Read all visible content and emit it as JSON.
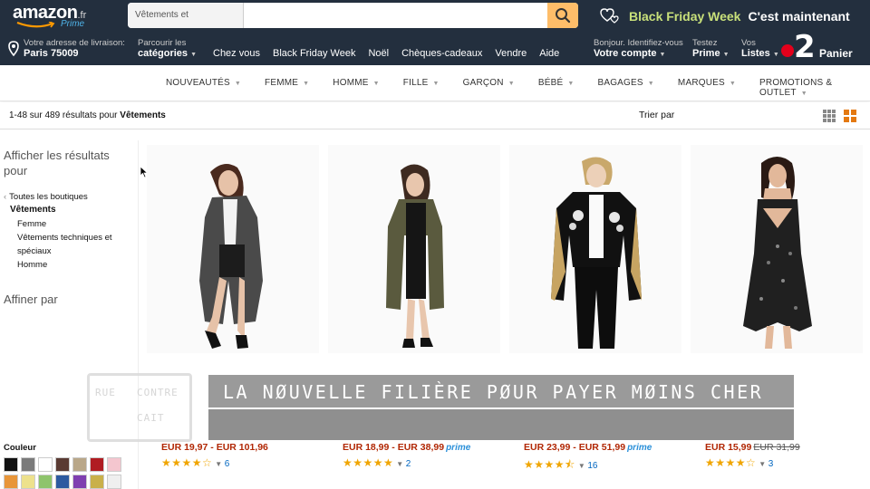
{
  "header": {
    "logo_text": "amazon",
    "logo_tld": ".fr",
    "logo_prime": "Prime",
    "search": {
      "category": "Vêtements et accessoires",
      "value": "",
      "placeholder": ""
    },
    "promo_bold": "Black Friday Week",
    "promo_white": "C'est maintenant"
  },
  "nav": {
    "address_label": "Votre adresse de livraison:",
    "address_value": "Paris 75009",
    "categories_label": "Parcourir les",
    "categories_value": "catégories",
    "links": [
      "Chez vous",
      "Black Friday Week",
      "Noël",
      "Chèques-cadeaux",
      "Vendre",
      "Aide"
    ],
    "account_label": "Bonjour. Identifiez-vous",
    "account_value": "Votre compte",
    "prime_label": "Testez",
    "prime_value": "Prime",
    "lists_label": "Vos",
    "lists_value": "Listes",
    "cart_count": "2",
    "cart_label": "Panier"
  },
  "subnav": {
    "items": [
      "NOUVEAUTÉS",
      "FEMME",
      "HOMME",
      "FILLE",
      "GARÇON",
      "BÉBÉ",
      "BAGAGES",
      "MARQUES",
      "PROMOTIONS & OUTLET"
    ]
  },
  "results": {
    "count_text": "1-48 sur 489 résultats pour",
    "query": "Vêtements",
    "sort_label": "Trier par"
  },
  "sidebar": {
    "heading": "Afficher les résultats pour",
    "all_stores": "Toutes les boutiques",
    "current": "Vêtements",
    "subcategories": [
      "Femme",
      "Vêtements techniques et spéciaux",
      "Homme"
    ],
    "refine": "Affiner par",
    "color_label": "Couleur",
    "colors": [
      "#111111",
      "#7a7a7a",
      "#ffffff",
      "#5a3a32",
      "#b9a789",
      "#b01c22",
      "#f4c6cf",
      "#e8963a",
      "#ede18c",
      "#8ec46c",
      "#2c5aa0",
      "#7f3fb0",
      "#c9b04a",
      "#efefef"
    ]
  },
  "products": [
    {
      "price": "EUR 19,97 - EUR 101,96",
      "was": "",
      "prime": true,
      "stars": 4,
      "reviews": "6"
    },
    {
      "price": "EUR 18,99 - EUR 38,99",
      "was": "",
      "prime": true,
      "stars": 5,
      "reviews": "2"
    },
    {
      "price": "EUR 23,99 - EUR 51,99",
      "was": "",
      "prime": true,
      "stars": 4.5,
      "reviews": "16"
    },
    {
      "price": "EUR 15,99",
      "was": "EUR 31,99",
      "prime": false,
      "stars": 4,
      "reviews": "3"
    }
  ],
  "prime_badge": "prime",
  "overlay": {
    "text": "LA NØUVELLE FILIÈRE PØUR PAYER MØINS CHER"
  },
  "stamp": {
    "lines": [
      "RUE",
      "CONTRE",
      "CAIT"
    ]
  },
  "colors": {
    "header_bg": "#232f3e",
    "search_button": "#febd69",
    "price": "#b12704",
    "stars": "#f0a500",
    "link": "#0066c0",
    "promo_green": "#c8e07a"
  }
}
